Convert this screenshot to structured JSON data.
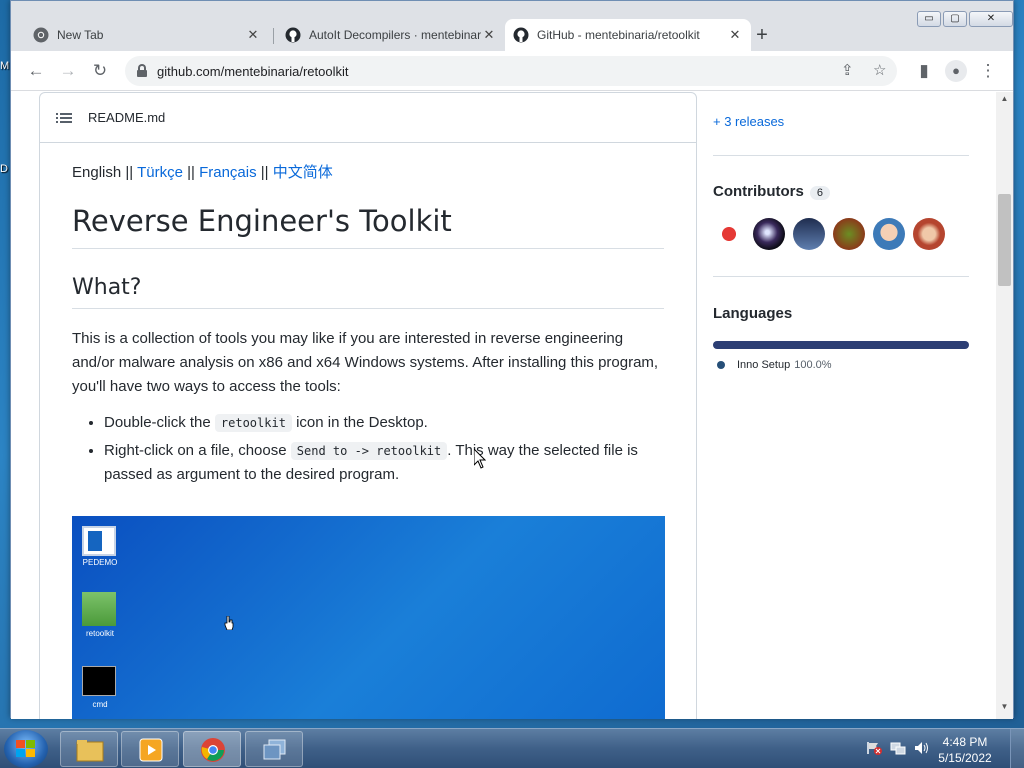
{
  "desktop": {
    "partial_labels": [
      "M",
      "D"
    ]
  },
  "browser": {
    "tabs": [
      {
        "title": "New Tab",
        "icon": "chrome-icon",
        "active": false
      },
      {
        "title": "AutoIt Decompilers · mentebinaria",
        "icon": "github-icon",
        "active": false
      },
      {
        "title": "GitHub - mentebinaria/retoolkit",
        "icon": "github-icon",
        "active": true
      }
    ],
    "close_glyph": "✕",
    "newtab_glyph": "+",
    "window_buttons": {
      "minimize": "▭",
      "maximize": "▢",
      "close": "✕"
    },
    "nav": {
      "back": "←",
      "forward": "→",
      "reload": "↻",
      "share": "⇪",
      "star": "☆",
      "sidepanel": "▮",
      "profile": "●",
      "menu": "⋮"
    },
    "url": "github.com/mentebinaria/retoolkit"
  },
  "readme": {
    "filename": "README.md",
    "lang_links": [
      {
        "label": "English",
        "link": false
      },
      {
        "label": "Türkçe",
        "link": true
      },
      {
        "label": "Français",
        "link": true
      },
      {
        "label": "中文简体",
        "link": true
      }
    ],
    "separator": "||",
    "title": "Reverse Engineer's Toolkit",
    "section": "What?",
    "intro": "This is a collection of tools you may like if you are interested in reverse engineering and/or malware analysis on x86 and x64 Windows systems. After installing this program, you'll have two ways to access the tools:",
    "bullet1": {
      "pre": "Double-click the ",
      "code": "retoolkit",
      "post": " icon in the Desktop."
    },
    "bullet2": {
      "pre": "Right-click on a file, choose ",
      "code": "Send to -> retoolkit",
      "post": ". This way the selected file is passed as argument to the desired program."
    },
    "screenshot_icons": [
      "PEDEMO",
      "retoolkit",
      "cmd"
    ]
  },
  "sidebar": {
    "releases": "+ 3 releases",
    "contributors": {
      "title": "Contributors",
      "count": "6"
    },
    "languages": {
      "title": "Languages",
      "name": "Inno Setup",
      "percent": "100.0%",
      "color": "#264f78"
    }
  },
  "taskbar": {
    "time": "4:48 PM",
    "date": "5/15/2022"
  }
}
